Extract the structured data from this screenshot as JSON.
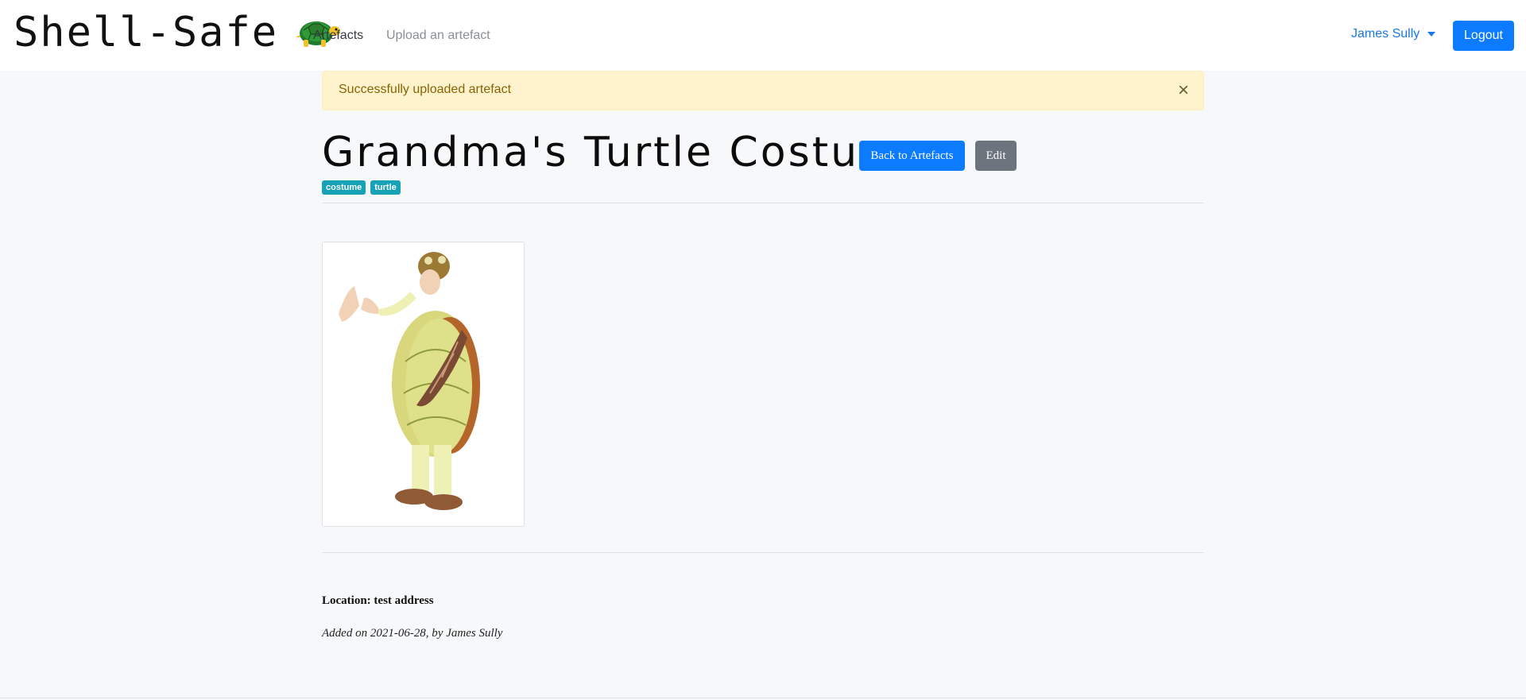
{
  "nav": {
    "brand": "Shell-Safe",
    "brand_icon": "turtle-icon",
    "links": [
      "Artefacts",
      "Upload an artefact"
    ],
    "user_name": "James Sully",
    "logout_label": "Logout"
  },
  "alert": {
    "message": "Successfully uploaded artefact",
    "close_label": "×"
  },
  "artefact": {
    "title": "Grandma's Turtle Costume",
    "back_label": "Back to Artefacts",
    "edit_label": "Edit",
    "tags": [
      "costume",
      "turtle"
    ],
    "image_icon": "turtle-costume-photo",
    "location": "Location: test address",
    "added": "Added on 2021-06-28, by James Sully"
  },
  "colors": {
    "primary": "#0d7bff",
    "secondary": "#6c757d",
    "tag": "#17a2b8",
    "alert_bg": "#fff3cd",
    "alert_text": "#856404"
  }
}
